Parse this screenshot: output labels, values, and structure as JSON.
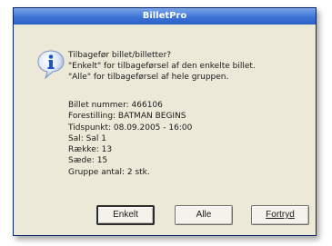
{
  "window": {
    "title": "BilletPro"
  },
  "message": {
    "icon": "info-icon",
    "lines": [
      "Tilbagefør billet/billetter?",
      "\"Enkelt\" for tilbageførsel af den enkelte billet.",
      "\"Alle\" for tilbageførsel af hele gruppen."
    ]
  },
  "details": {
    "lines": [
      "Billet nummer: 466106",
      "Forestilling: BATMAN BEGINS",
      "Tidspunkt: 08.09.2005 - 16:00",
      "Sal: Sal 1",
      "Række: 13",
      "Sæde: 15",
      "Gruppe antal: 2 stk."
    ]
  },
  "buttons": {
    "enkelt": "Enkelt",
    "alle": "Alle",
    "fortryd": "Fortryd"
  },
  "colors": {
    "titlebar": "#3d74d6",
    "dialog_bg": "#ece9d8"
  }
}
